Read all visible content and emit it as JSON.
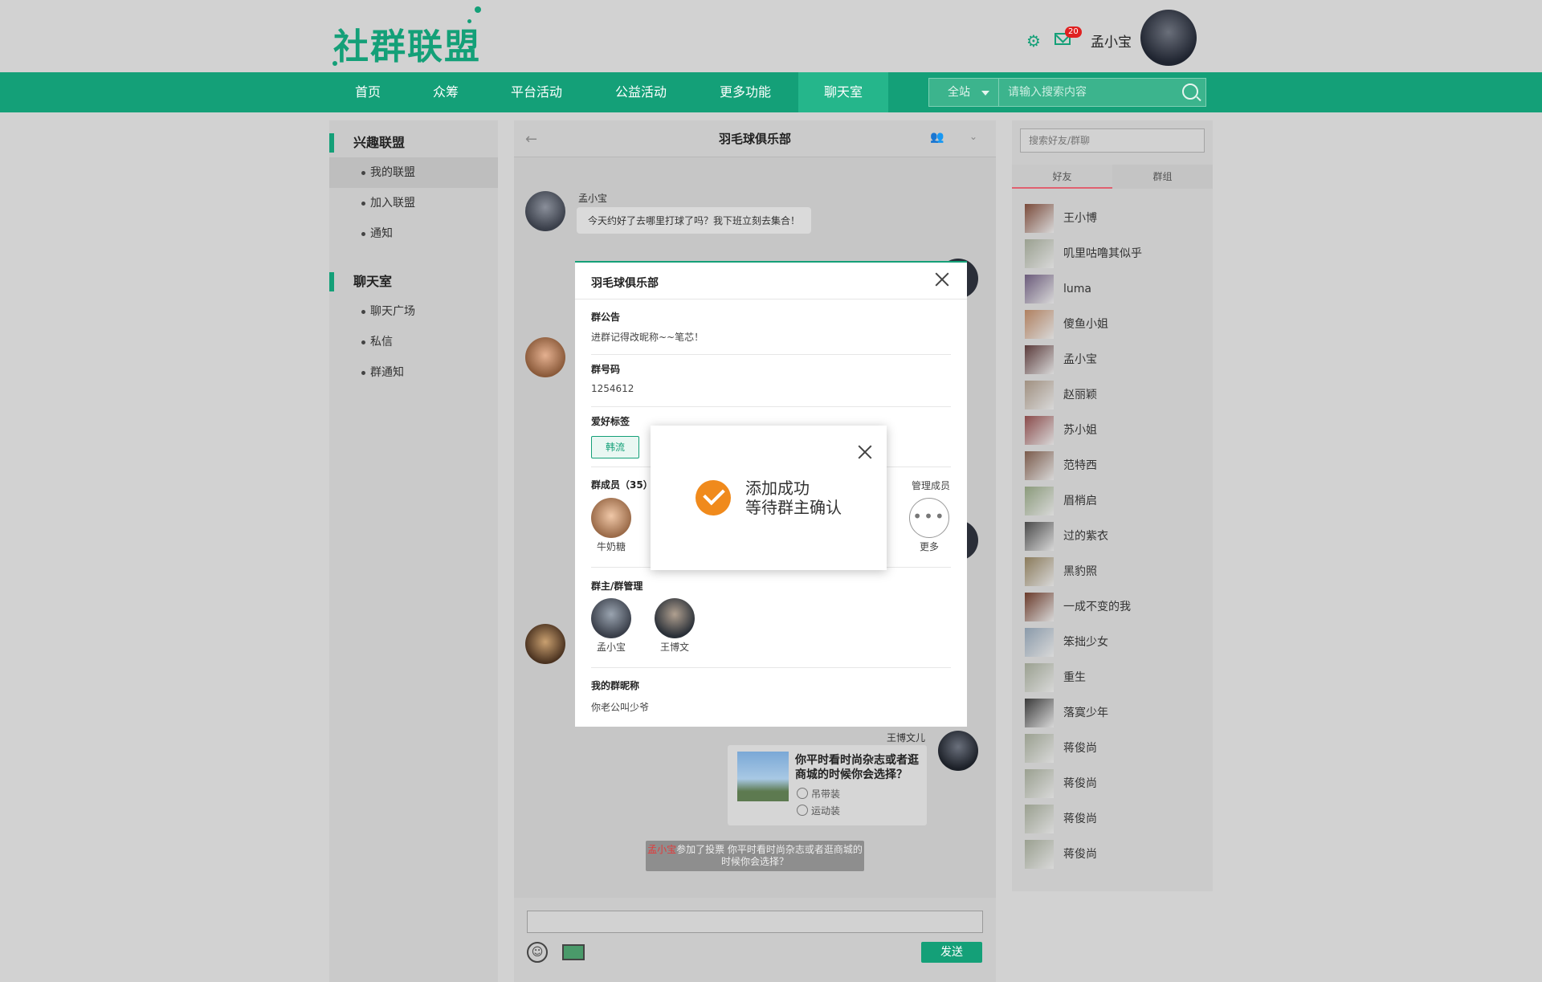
{
  "header": {
    "logo": "社群联盟",
    "mail_badge": "20",
    "username": "孟小宝"
  },
  "nav": {
    "items": [
      "首页",
      "众筹",
      "平台活动",
      "公益活动",
      "更多功能",
      "聊天室"
    ],
    "active": "聊天室",
    "search_scope": "全站",
    "search_placeholder": "请输入搜索内容"
  },
  "sidebar": {
    "sections": [
      {
        "title": "兴趣联盟",
        "items": [
          "我的联盟",
          "加入联盟",
          "通知"
        ]
      },
      {
        "title": "聊天室",
        "items": [
          "聊天广场",
          "私信",
          "群通知"
        ]
      }
    ],
    "active_item": "我的联盟"
  },
  "chat": {
    "title": "羽毛球俱乐部",
    "messages": [
      {
        "name": "孟小宝",
        "text": "今天约好了去哪里打球了吗？我下班立刻去集合！"
      }
    ],
    "right_sender": "王博文儿",
    "vote": {
      "question": "你平时看时尚杂志或者逛商城的时候你会选择？",
      "options": [
        "吊带装",
        "运动装"
      ]
    },
    "notice": {
      "actor": "孟小宝",
      "text": "参加了投票 你平时看时尚杂志或者逛商城的时候你会选择？"
    },
    "send_label": "发送"
  },
  "right": {
    "search_placeholder": "搜索好友/群聊",
    "tabs": [
      "好友",
      "群组"
    ],
    "friends": [
      "王小博",
      "叽里咕噜其似乎",
      "luma",
      "傻鱼小姐",
      "孟小宝",
      "赵丽颖",
      "苏小姐",
      "范特西",
      "眉梢启",
      "过的紫衣",
      "黑豹照",
      "一成不变的我",
      "笨拙少女",
      "重生",
      "落寞少年",
      "蒋俊尚",
      "蒋俊尚",
      "蒋俊尚",
      "蒋俊尚"
    ]
  },
  "modal": {
    "title": "羽毛球俱乐部",
    "notice_label": "群公告",
    "notice_value": "进群记得改昵称~~笔芯！",
    "id_label": "群号码",
    "id_value": "1254612",
    "tags_label": "爱好标签",
    "tag": "韩流",
    "members_label": "群成员（35）",
    "manage_label": "管理成员",
    "member_name": "牛奶糖",
    "more_label": "更多",
    "admins_label": "群主/群管理",
    "admins": [
      "孟小宝",
      "王博文"
    ],
    "nickname_label": "我的群昵称",
    "nickname_value": "你老公叫少爷"
  },
  "toast": {
    "line1": "添加成功",
    "line2": "等待群主确认"
  },
  "colors": {
    "brand": "#14a078",
    "success_check": "#f08a1c",
    "badge": "#e02020"
  }
}
